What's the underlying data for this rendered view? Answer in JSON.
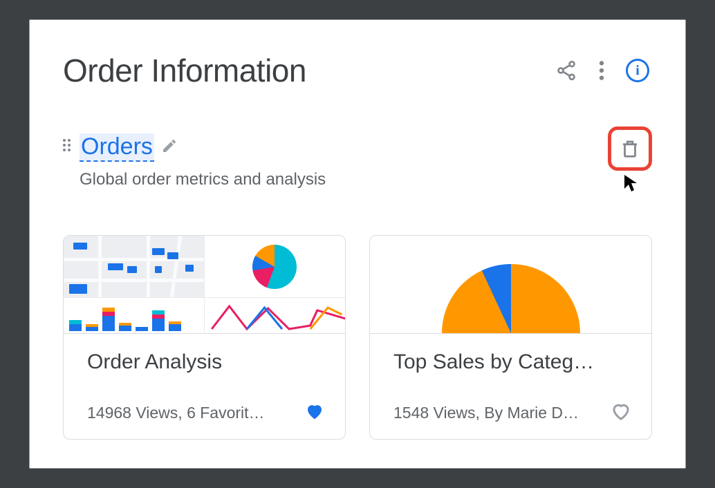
{
  "header": {
    "title": "Order Information",
    "icons": {
      "share": "share-icon",
      "more": "more-vert-icon",
      "info": "info-icon"
    },
    "info_glyph": "i"
  },
  "section": {
    "title": "Orders",
    "subtitle": "Global order metrics and analysis",
    "edit_icon": "pencil-icon",
    "delete_icon": "trash-icon",
    "drag_icon": "drag-handle-icon"
  },
  "cards": [
    {
      "title": "Order Analysis",
      "meta": "14968 Views, 6 Favorit…",
      "favorite": true
    },
    {
      "title": "Top Sales by Categ…",
      "meta": "1548 Views, By Marie D…",
      "favorite": false
    }
  ],
  "colors": {
    "accent": "#1a73e8",
    "danger": "#ea4335",
    "teal": "#00bcd4",
    "pink": "#e91e63",
    "orange": "#ff9800",
    "text": "#3c4043",
    "muted": "#5f6368"
  }
}
